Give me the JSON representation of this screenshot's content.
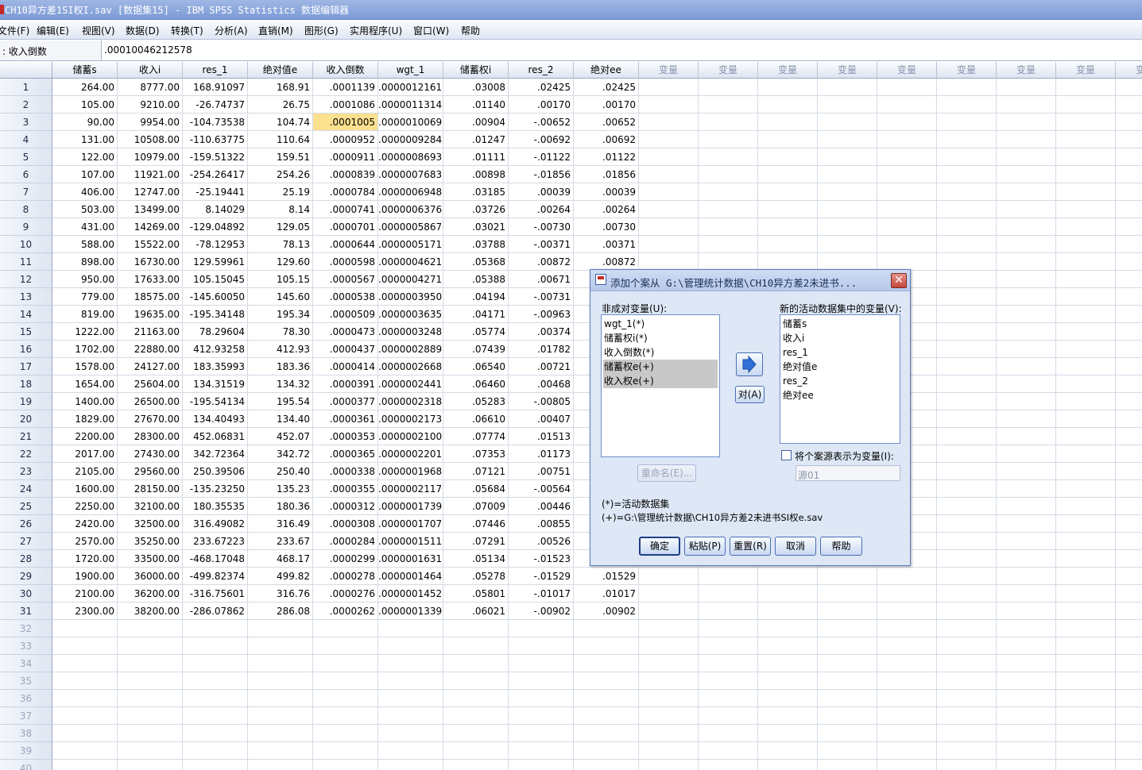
{
  "window": {
    "title": "CH10异方差1SI权I.sav [数据集15] - IBM SPSS Statistics 数据编辑器"
  },
  "menubar": {
    "items": [
      "文件(F)",
      "编辑(E)",
      "视图(V)",
      "数据(D)",
      "转换(T)",
      "分析(A)",
      "直销(M)",
      "图形(G)",
      "实用程序(U)",
      "窗口(W)",
      "帮助"
    ]
  },
  "cell_editor": {
    "cell_name": ": 收入倒数",
    "cell_value": ".00010046212578"
  },
  "grid": {
    "columns": [
      "储蓄s",
      "收入i",
      "res_1",
      "绝对值e",
      "收入倒数",
      "wgt_1",
      "储蓄权i",
      "res_2",
      "绝对ee"
    ],
    "empty_column_label": "变量",
    "selected": {
      "row": 3,
      "column": "收入倒数"
    },
    "rows": [
      [
        "264.00",
        "8777.00",
        "168.91097",
        "168.91",
        ".0001139",
        ".0000012161",
        ".03008",
        ".02425",
        ".02425"
      ],
      [
        "105.00",
        "9210.00",
        "-26.74737",
        "26.75",
        ".0001086",
        ".0000011314",
        ".01140",
        ".00170",
        ".00170"
      ],
      [
        "90.00",
        "9954.00",
        "-104.73538",
        "104.74",
        ".0001005",
        ".0000010069",
        ".00904",
        "-.00652",
        ".00652"
      ],
      [
        "131.00",
        "10508.00",
        "-110.63775",
        "110.64",
        ".0000952",
        ".0000009284",
        ".01247",
        "-.00692",
        ".00692"
      ],
      [
        "122.00",
        "10979.00",
        "-159.51322",
        "159.51",
        ".0000911",
        ".0000008693",
        ".01111",
        "-.01122",
        ".01122"
      ],
      [
        "107.00",
        "11921.00",
        "-254.26417",
        "254.26",
        ".0000839",
        ".0000007683",
        ".00898",
        "-.01856",
        ".01856"
      ],
      [
        "406.00",
        "12747.00",
        "-25.19441",
        "25.19",
        ".0000784",
        ".0000006948",
        ".03185",
        ".00039",
        ".00039"
      ],
      [
        "503.00",
        "13499.00",
        "8.14029",
        "8.14",
        ".0000741",
        ".0000006376",
        ".03726",
        ".00264",
        ".00264"
      ],
      [
        "431.00",
        "14269.00",
        "-129.04892",
        "129.05",
        ".0000701",
        ".0000005867",
        ".03021",
        "-.00730",
        ".00730"
      ],
      [
        "588.00",
        "15522.00",
        "-78.12953",
        "78.13",
        ".0000644",
        ".0000005171",
        ".03788",
        "-.00371",
        ".00371"
      ],
      [
        "898.00",
        "16730.00",
        "129.59961",
        "129.60",
        ".0000598",
        ".0000004621",
        ".05368",
        ".00872",
        ".00872"
      ],
      [
        "950.00",
        "17633.00",
        "105.15045",
        "105.15",
        ".0000567",
        ".0000004271",
        ".05388",
        ".00671",
        ""
      ],
      [
        "779.00",
        "18575.00",
        "-145.60050",
        "145.60",
        ".0000538",
        ".0000003950",
        ".04194",
        "-.00731",
        ""
      ],
      [
        "819.00",
        "19635.00",
        "-195.34148",
        "195.34",
        ".0000509",
        ".0000003635",
        ".04171",
        "-.00963",
        ""
      ],
      [
        "1222.00",
        "21163.00",
        "78.29604",
        "78.30",
        ".0000473",
        ".0000003248",
        ".05774",
        ".00374",
        ""
      ],
      [
        "1702.00",
        "22880.00",
        "412.93258",
        "412.93",
        ".0000437",
        ".0000002889",
        ".07439",
        ".01782",
        ""
      ],
      [
        "1578.00",
        "24127.00",
        "183.35993",
        "183.36",
        ".0000414",
        ".0000002668",
        ".06540",
        ".00721",
        ""
      ],
      [
        "1654.00",
        "25604.00",
        "134.31519",
        "134.32",
        ".0000391",
        ".0000002441",
        ".06460",
        ".00468",
        ""
      ],
      [
        "1400.00",
        "26500.00",
        "-195.54134",
        "195.54",
        ".0000377",
        ".0000002318",
        ".05283",
        "-.00805",
        ""
      ],
      [
        "1829.00",
        "27670.00",
        "134.40493",
        "134.40",
        ".0000361",
        ".0000002173",
        ".06610",
        ".00407",
        ""
      ],
      [
        "2200.00",
        "28300.00",
        "452.06831",
        "452.07",
        ".0000353",
        ".0000002100",
        ".07774",
        ".01513",
        ""
      ],
      [
        "2017.00",
        "27430.00",
        "342.72364",
        "342.72",
        ".0000365",
        ".0000002201",
        ".07353",
        ".01173",
        ""
      ],
      [
        "2105.00",
        "29560.00",
        "250.39506",
        "250.40",
        ".0000338",
        ".0000001968",
        ".07121",
        ".00751",
        ""
      ],
      [
        "1600.00",
        "28150.00",
        "-135.23250",
        "135.23",
        ".0000355",
        ".0000002117",
        ".05684",
        "-.00564",
        ""
      ],
      [
        "2250.00",
        "32100.00",
        "180.35535",
        "180.36",
        ".0000312",
        ".0000001739",
        ".07009",
        ".00446",
        ""
      ],
      [
        "2420.00",
        "32500.00",
        "316.49082",
        "316.49",
        ".0000308",
        ".0000001707",
        ".07446",
        ".00855",
        ""
      ],
      [
        "2570.00",
        "35250.00",
        "233.67223",
        "233.67",
        ".0000284",
        ".0000001511",
        ".07291",
        ".00526",
        ""
      ],
      [
        "1720.00",
        "33500.00",
        "-468.17048",
        "468.17",
        ".0000299",
        ".0000001631",
        ".05134",
        "-.01523",
        ""
      ],
      [
        "1900.00",
        "36000.00",
        "-499.82374",
        "499.82",
        ".0000278",
        ".0000001464",
        ".05278",
        "-.01529",
        ".01529"
      ],
      [
        "2100.00",
        "36200.00",
        "-316.75601",
        "316.76",
        ".0000276",
        ".0000001452",
        ".05801",
        "-.01017",
        ".01017"
      ],
      [
        "2300.00",
        "38200.00",
        "-286.07862",
        "286.08",
        ".0000262",
        ".0000001339",
        ".06021",
        "-.00902",
        ".00902"
      ]
    ],
    "empty_rows": [
      "32",
      "33",
      "34",
      "35",
      "36",
      "37",
      "38",
      "39",
      "40"
    ]
  },
  "dialog": {
    "title": "添加个案从 G:\\管理统计数据\\CH10异方差2未进书...",
    "unpaired_label": "非成对变量(U):",
    "unpaired_items": [
      {
        "label": "wgt_1(*)",
        "highlighted": false
      },
      {
        "label": "储蓄权i(*)",
        "highlighted": false
      },
      {
        "label": "收入倒数(*)",
        "highlighted": false
      },
      {
        "label": "储蓄权e(+)",
        "highlighted": true
      },
      {
        "label": "收入权e(+)",
        "highlighted": true
      }
    ],
    "new_vars_label": "新的活动数据集中的变量(V):",
    "new_vars_items": [
      "储蓄s",
      "收入i",
      "res_1",
      "绝对值e",
      "res_2",
      "绝对ee"
    ],
    "pair_button": "对(A)",
    "rename_button": "重命名(E)...",
    "indicate_source_label": "将个案源表示为变量(I):",
    "source_field": "源01",
    "note_active": "(*)=活动数据集",
    "note_other": "(+)=G:\\管理统计数据\\CH10异方差2未进书SI权e.sav",
    "buttons": {
      "ok": "确定",
      "paste": "粘贴(P)",
      "reset": "重置(R)",
      "cancel": "取消",
      "help": "帮助"
    }
  }
}
